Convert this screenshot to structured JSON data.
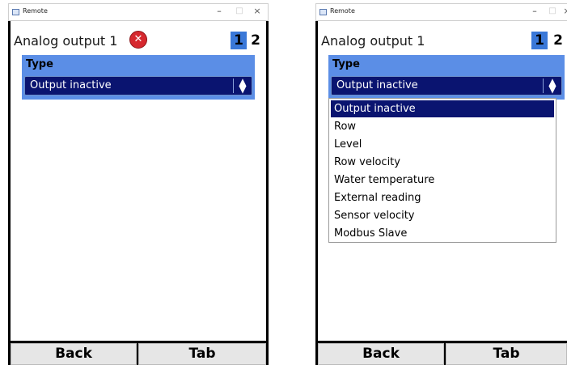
{
  "window_title": "Remote",
  "titlebar_buttons": {
    "minimize": "–",
    "maximize": "□",
    "close": "×"
  },
  "screen": {
    "heading": "Analog output 1",
    "tabs": [
      "1",
      "2"
    ],
    "active_tab": "1",
    "field_label": "Type",
    "selected_value": "Output inactive",
    "select_arrows": "▲▼",
    "error_icon_glyph": "✕",
    "options": [
      "Output inactive",
      "Row",
      "Level",
      "Row velocity",
      "Water temperature",
      "External reading",
      "Sensor velocity",
      "Modbus Slave"
    ],
    "buttons": {
      "back": "Back",
      "tab": "Tab"
    }
  },
  "colors": {
    "accent": "#5b8ee6",
    "select_bg": "#0a1470",
    "tab_active": "#3a78d8",
    "error": "#d6282e"
  }
}
